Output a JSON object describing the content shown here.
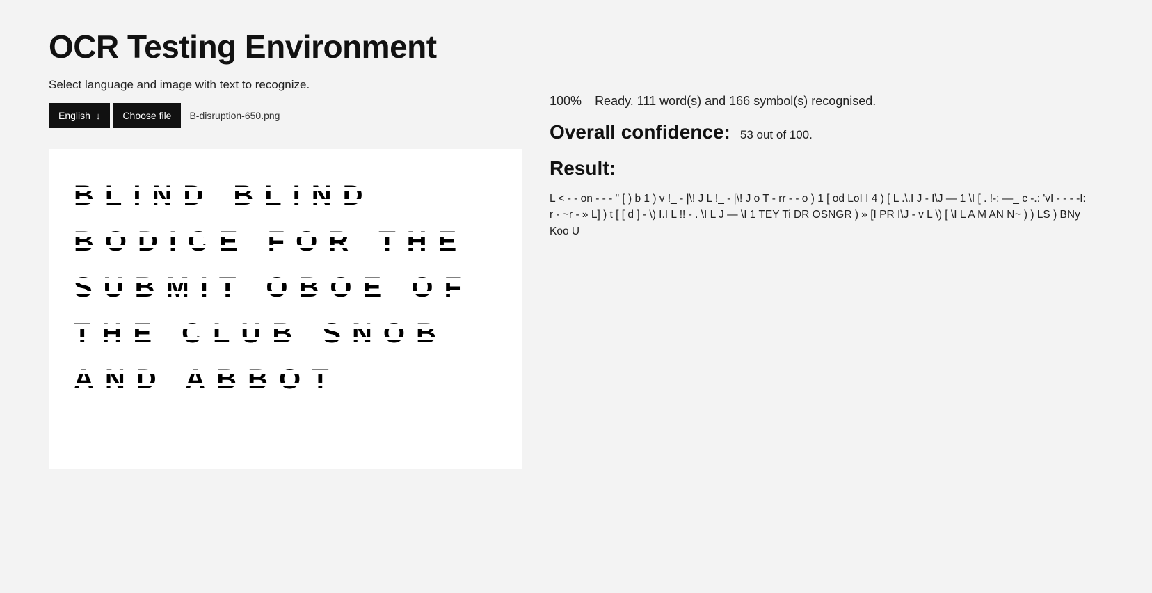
{
  "header": {
    "title": "OCR Testing Environment",
    "subtitle": "Select language and image with text to recognize."
  },
  "controls": {
    "language_label": "English",
    "choose_file_label": "Choose file",
    "selected_filename": "B-disruption-650.png"
  },
  "preview": {
    "lines": [
      "BLIND BLIND",
      "BODICE FOR THE",
      "SUBMIT OBOE OF",
      "THE CLUB SNOB",
      "AND ABBOT"
    ]
  },
  "status": {
    "percent": "100%",
    "message": "Ready. 111 word(s) and 166 symbol(s) recognised."
  },
  "confidence": {
    "label": "Overall confidence:",
    "value": "53 out of 100."
  },
  "result": {
    "label": "Result:",
    "text": "L < - - on - - - \" [ ) b 1 ) v !_ - |\\! J L !_ - |\\! J o T - rr - - o ) 1 [ od LoI I 4 ) [ L .\\.I J - I\\J — 1 \\I [ . !-: —_ c -.: 'vI - - - -I: r - ~r - » L] ) t [ [ d ] - \\) I.I L !! - . \\I L J — \\I 1 TEY Ti DR OSNGR ) » [I PR I\\J - v L \\) [ \\I L A M AN N~ ) ) LS ) BNy Koo U"
  }
}
